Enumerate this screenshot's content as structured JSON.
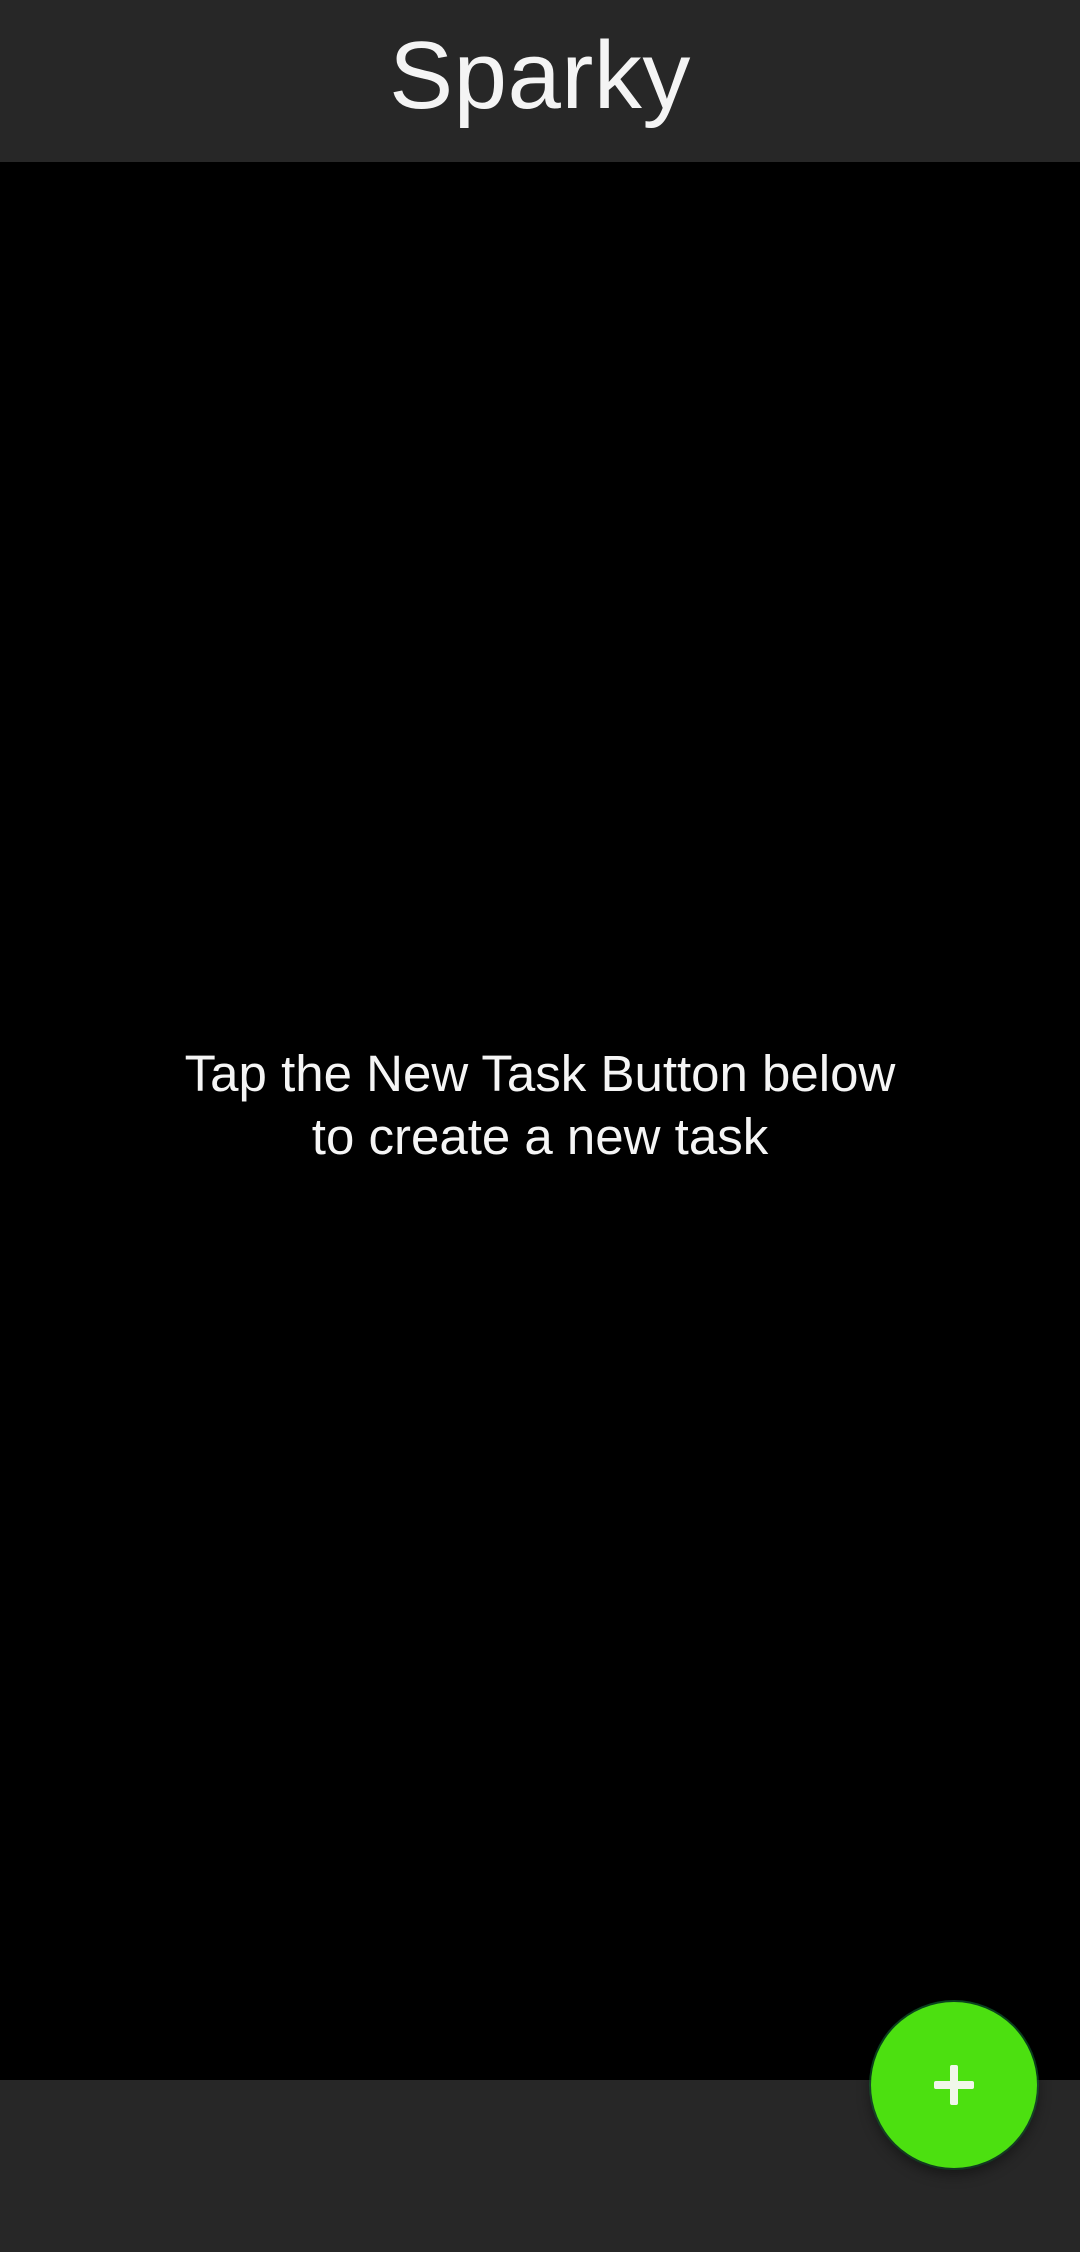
{
  "app": {
    "title": "Sparky"
  },
  "main": {
    "empty_message_line1": "Tap the New Task Button below",
    "empty_message_line2": "to create a new task"
  },
  "fab": {
    "icon": "plus-icon",
    "color": "#4ce010"
  },
  "colors": {
    "bar_background": "#272727",
    "content_background": "#000000",
    "text": "#f4f4f4"
  }
}
